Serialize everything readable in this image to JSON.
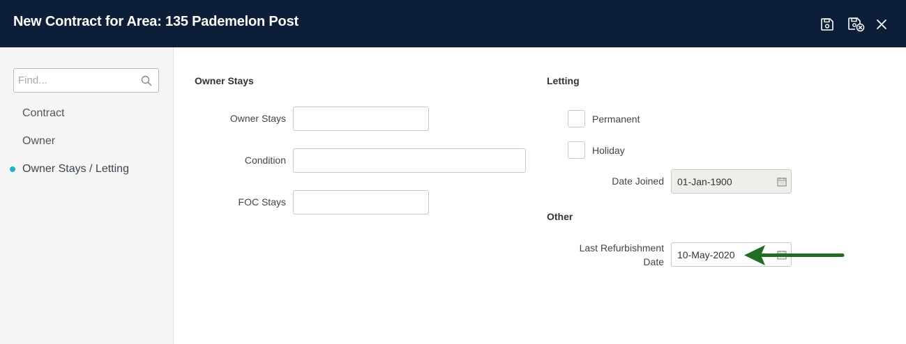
{
  "header": {
    "title": "New Contract for Area: 135 Pademelon Post",
    "save_icon": "floppy-disk-icon",
    "save_close_icon": "floppy-disk-close-icon",
    "close_icon": "close-icon"
  },
  "sidebar": {
    "search_placeholder": "Find...",
    "items": [
      {
        "label": "Contract"
      },
      {
        "label": "Owner"
      },
      {
        "label": "Owner Stays / Letting",
        "active": true
      }
    ]
  },
  "owner_stays": {
    "title": "Owner Stays",
    "fields": [
      {
        "label": "Owner Stays",
        "value": ""
      },
      {
        "label": "Condition",
        "value": ""
      },
      {
        "label": "FOC Stays",
        "value": ""
      }
    ]
  },
  "letting": {
    "title": "Letting",
    "permanent_label": "Permanent",
    "holiday_label": "Holiday",
    "date_joined_label": "Date Joined",
    "date_joined_value": "01-Jan-1900"
  },
  "other": {
    "title": "Other",
    "last_refurbishment_label_line1": "Last Refurbishment",
    "last_refurbishment_label_line2": "Date",
    "last_refurbishment_value": "10-May-2020"
  },
  "colors": {
    "header_bg": "#0d1f38",
    "active_dot": "#17b3cc",
    "annotation_arrow": "#1f6e24"
  }
}
